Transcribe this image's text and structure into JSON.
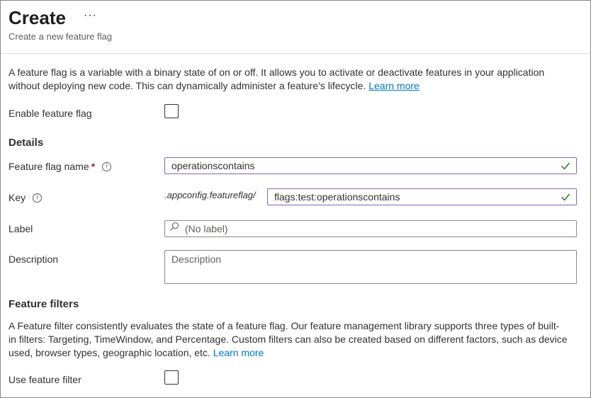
{
  "header": {
    "title": "Create",
    "more_label": "···",
    "subtitle": "Create a new feature flag"
  },
  "intro": {
    "line1": "A feature flag is a variable with a binary state of on or off. It allows you to activate or deactivate features in your application",
    "line2": "without deploying new code. This can dynamically administer a feature's lifecycle.",
    "link": "Learn more"
  },
  "enable": {
    "label": "Enable feature flag",
    "checked": false
  },
  "details": {
    "heading": "Details",
    "name_label": "Feature flag name",
    "required_mark": "*",
    "name_value": "operationscontains",
    "key_label": "Key",
    "key_prefix": ".appconfig.featureflag/",
    "key_value": "flags:test:operationscontains",
    "label_label": "Label",
    "label_placeholder": "(No label)",
    "description_label": "Description",
    "description_placeholder": "Description"
  },
  "filters": {
    "heading": "Feature filters",
    "line1": "A Feature filter consistently evaluates the state of a feature flag. Our feature management library supports three types of built-",
    "line2": "in filters: Targeting, TimeWindow, and Percentage. Custom filters can also be created based on different factors, such as device",
    "line3": "used, browser types, geographic location, etc.",
    "link": "Learn more",
    "use_label": "Use feature filter",
    "use_checked": false
  },
  "icons": {
    "info": "info-icon",
    "valid": "checkmark-icon",
    "search": "search-icon"
  },
  "colors": {
    "accent": "#0078d4",
    "valid": "#107c10",
    "focus_border": "#8764b8",
    "required": "#a4262c"
  }
}
